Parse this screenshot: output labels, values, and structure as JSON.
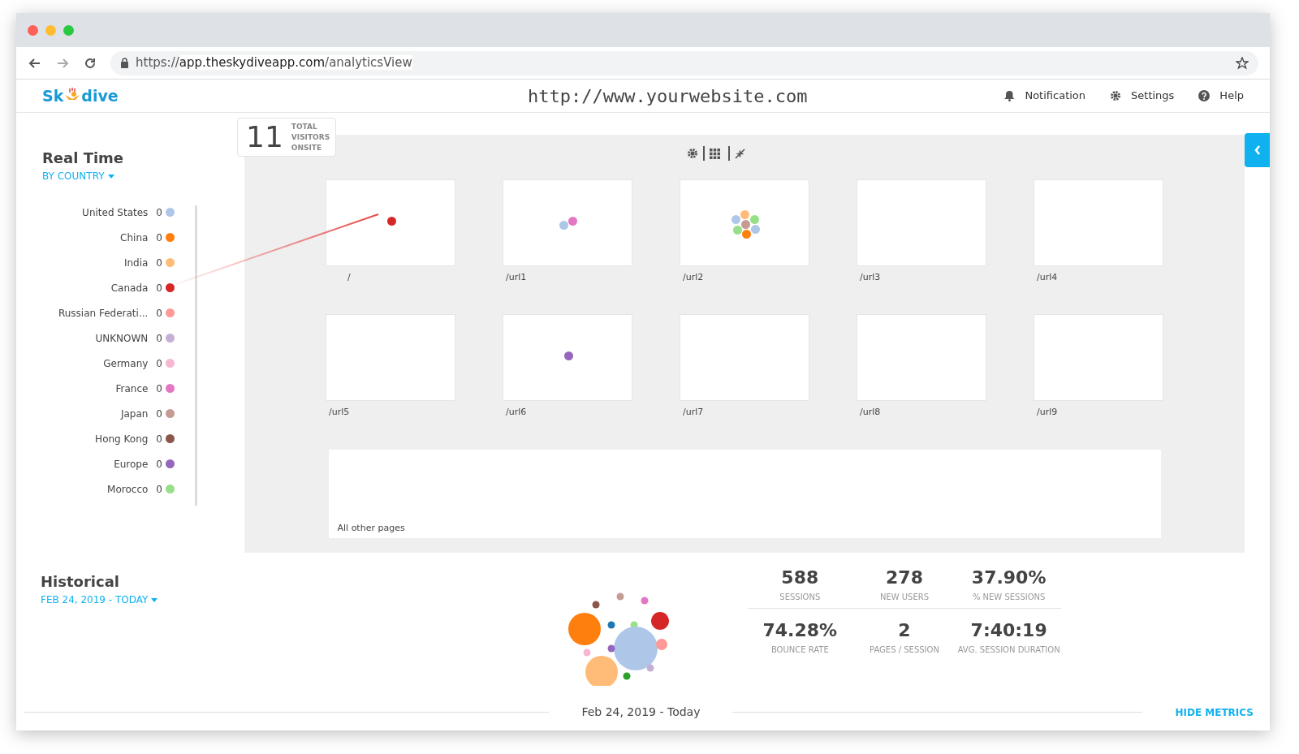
{
  "browser": {
    "url_scheme": "https://",
    "url_host": "app.theskydiveapp.com",
    "url_path": "/analyticsView"
  },
  "header": {
    "logo_left": "Sk",
    "logo_right": "dive",
    "site": "http://www.yourwebsite.com",
    "actions": [
      {
        "kind": "bell",
        "label": "Notification"
      },
      {
        "kind": "gear",
        "label": "Settings"
      },
      {
        "kind": "help",
        "label": "Help"
      }
    ]
  },
  "realtime": {
    "title": "Real Time",
    "filter": "BY COUNTRY",
    "countries": [
      {
        "name": "United States",
        "count": "0",
        "color": "#aec7e8"
      },
      {
        "name": "China",
        "count": "0",
        "color": "#ff7f0e"
      },
      {
        "name": "India",
        "count": "0",
        "color": "#ffbb78"
      },
      {
        "name": "Canada",
        "count": "0",
        "color": "#d62728"
      },
      {
        "name": "Russian Federati...",
        "count": "0",
        "color": "#ff9896"
      },
      {
        "name": "UNKNOWN",
        "count": "0",
        "color": "#c5b0d5"
      },
      {
        "name": "Germany",
        "count": "0",
        "color": "#f7b6d2"
      },
      {
        "name": "France",
        "count": "0",
        "color": "#e377c2"
      },
      {
        "name": "Japan",
        "count": "0",
        "color": "#c49c94"
      },
      {
        "name": "Hong Kong",
        "count": "0",
        "color": "#8c564b"
      },
      {
        "name": "Europe",
        "count": "0",
        "color": "#9467bd"
      },
      {
        "name": "Morocco",
        "count": "0",
        "color": "#98df8a"
      }
    ]
  },
  "visitors": {
    "count": "11",
    "label_lines": [
      "TOTAL",
      "VISITORS",
      "ONSITE"
    ]
  },
  "pages": [
    {
      "label": "/",
      "visitors": [
        {
          "color": "#d62728"
        }
      ]
    },
    {
      "label": "/url1",
      "visitors": [
        {
          "color": "#aec7e8"
        },
        {
          "color": "#e377c2"
        }
      ]
    },
    {
      "label": "/url2",
      "visitors": [
        {
          "color": "#aec7e8"
        },
        {
          "color": "#ffbb78"
        },
        {
          "color": "#98df8a"
        },
        {
          "color": "#c49c94"
        },
        {
          "color": "#98df8a"
        },
        {
          "color": "#aec7e8"
        },
        {
          "color": "#ff7f0e"
        }
      ]
    },
    {
      "label": "/url3"
    },
    {
      "label": "/url4"
    },
    {
      "label": "/url5"
    },
    {
      "label": "/url6",
      "visitors": [
        {
          "color": "#9467bd"
        }
      ]
    },
    {
      "label": "/url7"
    },
    {
      "label": "/url8"
    },
    {
      "label": "/url9"
    }
  ],
  "other_pages": {
    "label": "All other pages"
  },
  "historical": {
    "title": "Historical",
    "filter": "FEB 24, 2019 - TODAY",
    "range": "Feb 24, 2019 - Today",
    "hide_metrics": "HIDE METRICS",
    "metrics": [
      {
        "value": "588",
        "label": "SESSIONS"
      },
      {
        "value": "278",
        "label": "NEW USERS"
      },
      {
        "value": "37.90%",
        "label": "% NEW SESSIONS"
      },
      {
        "value": "74.28%",
        "label": "BOUNCE RATE"
      },
      {
        "value": "2",
        "label": "PAGES / SESSION"
      },
      {
        "value": "7:40:19",
        "label": "AVG. SESSION DURATION"
      }
    ]
  }
}
